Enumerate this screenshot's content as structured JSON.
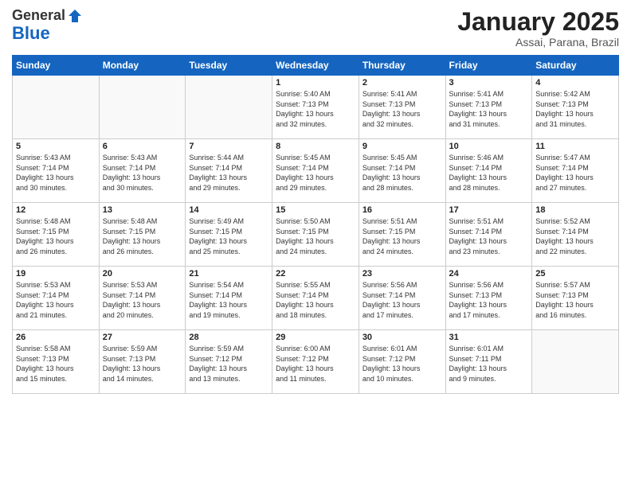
{
  "header": {
    "logo_general": "General",
    "logo_blue": "Blue",
    "title": "January 2025",
    "subtitle": "Assai, Parana, Brazil"
  },
  "weekdays": [
    "Sunday",
    "Monday",
    "Tuesday",
    "Wednesday",
    "Thursday",
    "Friday",
    "Saturday"
  ],
  "weeks": [
    [
      {
        "day": "",
        "info": ""
      },
      {
        "day": "",
        "info": ""
      },
      {
        "day": "",
        "info": ""
      },
      {
        "day": "1",
        "info": "Sunrise: 5:40 AM\nSunset: 7:13 PM\nDaylight: 13 hours\nand 32 minutes."
      },
      {
        "day": "2",
        "info": "Sunrise: 5:41 AM\nSunset: 7:13 PM\nDaylight: 13 hours\nand 32 minutes."
      },
      {
        "day": "3",
        "info": "Sunrise: 5:41 AM\nSunset: 7:13 PM\nDaylight: 13 hours\nand 31 minutes."
      },
      {
        "day": "4",
        "info": "Sunrise: 5:42 AM\nSunset: 7:13 PM\nDaylight: 13 hours\nand 31 minutes."
      }
    ],
    [
      {
        "day": "5",
        "info": "Sunrise: 5:43 AM\nSunset: 7:14 PM\nDaylight: 13 hours\nand 30 minutes."
      },
      {
        "day": "6",
        "info": "Sunrise: 5:43 AM\nSunset: 7:14 PM\nDaylight: 13 hours\nand 30 minutes."
      },
      {
        "day": "7",
        "info": "Sunrise: 5:44 AM\nSunset: 7:14 PM\nDaylight: 13 hours\nand 29 minutes."
      },
      {
        "day": "8",
        "info": "Sunrise: 5:45 AM\nSunset: 7:14 PM\nDaylight: 13 hours\nand 29 minutes."
      },
      {
        "day": "9",
        "info": "Sunrise: 5:45 AM\nSunset: 7:14 PM\nDaylight: 13 hours\nand 28 minutes."
      },
      {
        "day": "10",
        "info": "Sunrise: 5:46 AM\nSunset: 7:14 PM\nDaylight: 13 hours\nand 28 minutes."
      },
      {
        "day": "11",
        "info": "Sunrise: 5:47 AM\nSunset: 7:14 PM\nDaylight: 13 hours\nand 27 minutes."
      }
    ],
    [
      {
        "day": "12",
        "info": "Sunrise: 5:48 AM\nSunset: 7:15 PM\nDaylight: 13 hours\nand 26 minutes."
      },
      {
        "day": "13",
        "info": "Sunrise: 5:48 AM\nSunset: 7:15 PM\nDaylight: 13 hours\nand 26 minutes."
      },
      {
        "day": "14",
        "info": "Sunrise: 5:49 AM\nSunset: 7:15 PM\nDaylight: 13 hours\nand 25 minutes."
      },
      {
        "day": "15",
        "info": "Sunrise: 5:50 AM\nSunset: 7:15 PM\nDaylight: 13 hours\nand 24 minutes."
      },
      {
        "day": "16",
        "info": "Sunrise: 5:51 AM\nSunset: 7:15 PM\nDaylight: 13 hours\nand 24 minutes."
      },
      {
        "day": "17",
        "info": "Sunrise: 5:51 AM\nSunset: 7:14 PM\nDaylight: 13 hours\nand 23 minutes."
      },
      {
        "day": "18",
        "info": "Sunrise: 5:52 AM\nSunset: 7:14 PM\nDaylight: 13 hours\nand 22 minutes."
      }
    ],
    [
      {
        "day": "19",
        "info": "Sunrise: 5:53 AM\nSunset: 7:14 PM\nDaylight: 13 hours\nand 21 minutes."
      },
      {
        "day": "20",
        "info": "Sunrise: 5:53 AM\nSunset: 7:14 PM\nDaylight: 13 hours\nand 20 minutes."
      },
      {
        "day": "21",
        "info": "Sunrise: 5:54 AM\nSunset: 7:14 PM\nDaylight: 13 hours\nand 19 minutes."
      },
      {
        "day": "22",
        "info": "Sunrise: 5:55 AM\nSunset: 7:14 PM\nDaylight: 13 hours\nand 18 minutes."
      },
      {
        "day": "23",
        "info": "Sunrise: 5:56 AM\nSunset: 7:14 PM\nDaylight: 13 hours\nand 17 minutes."
      },
      {
        "day": "24",
        "info": "Sunrise: 5:56 AM\nSunset: 7:13 PM\nDaylight: 13 hours\nand 17 minutes."
      },
      {
        "day": "25",
        "info": "Sunrise: 5:57 AM\nSunset: 7:13 PM\nDaylight: 13 hours\nand 16 minutes."
      }
    ],
    [
      {
        "day": "26",
        "info": "Sunrise: 5:58 AM\nSunset: 7:13 PM\nDaylight: 13 hours\nand 15 minutes."
      },
      {
        "day": "27",
        "info": "Sunrise: 5:59 AM\nSunset: 7:13 PM\nDaylight: 13 hours\nand 14 minutes."
      },
      {
        "day": "28",
        "info": "Sunrise: 5:59 AM\nSunset: 7:12 PM\nDaylight: 13 hours\nand 13 minutes."
      },
      {
        "day": "29",
        "info": "Sunrise: 6:00 AM\nSunset: 7:12 PM\nDaylight: 13 hours\nand 11 minutes."
      },
      {
        "day": "30",
        "info": "Sunrise: 6:01 AM\nSunset: 7:12 PM\nDaylight: 13 hours\nand 10 minutes."
      },
      {
        "day": "31",
        "info": "Sunrise: 6:01 AM\nSunset: 7:11 PM\nDaylight: 13 hours\nand 9 minutes."
      },
      {
        "day": "",
        "info": ""
      }
    ]
  ]
}
